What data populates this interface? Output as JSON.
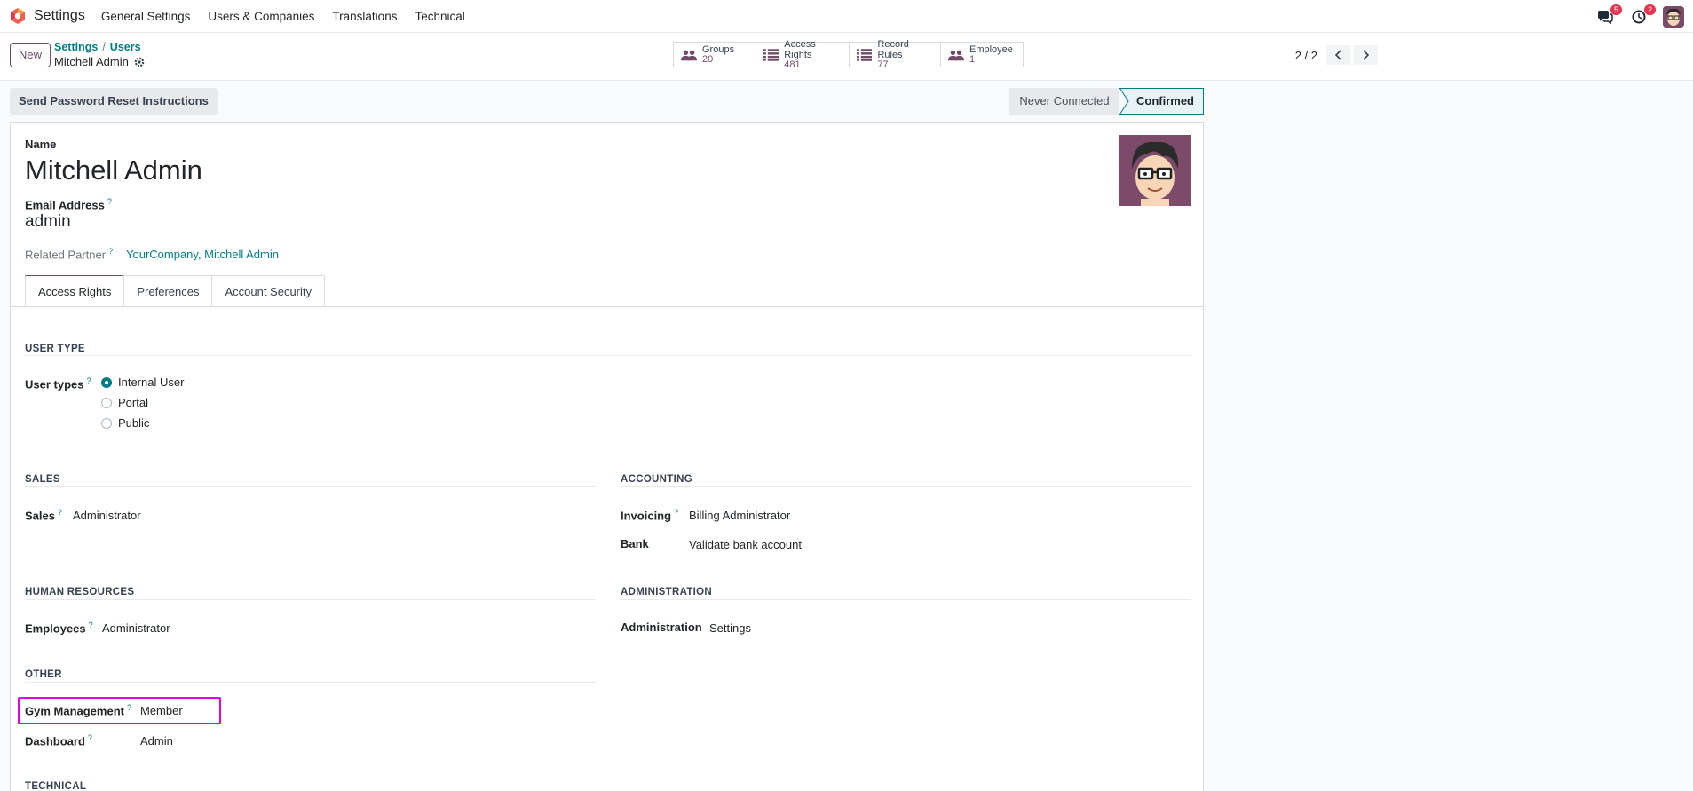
{
  "navbar": {
    "app_name": "Settings",
    "menus": [
      "General Settings",
      "Users & Companies",
      "Translations",
      "Technical"
    ],
    "messages_count": "5",
    "activities_count": "2"
  },
  "control_panel": {
    "new_label": "New",
    "breadcrumb_settings": "Settings",
    "breadcrumb_sep": "/",
    "breadcrumb_users": "Users",
    "record_name": "Mitchell Admin",
    "stats": [
      {
        "label": "Groups",
        "value": "20"
      },
      {
        "label": "Access Rights",
        "value": "481"
      },
      {
        "label": "Record Rules",
        "value": "77"
      },
      {
        "label": "Employee",
        "value": "1"
      }
    ],
    "pager": "2 / 2"
  },
  "statusbar": {
    "reset_button": "Send Password Reset Instructions",
    "stage_never": "Never Connected",
    "stage_confirmed": "Confirmed"
  },
  "form": {
    "name_label": "Name",
    "name_value": "Mitchell Admin",
    "email_label": "Email Address",
    "email_value": "admin",
    "partner_label": "Related Partner",
    "partner_value": "YourCompany, Mitchell Admin",
    "help_mark": "?"
  },
  "tabs": [
    "Access Rights",
    "Preferences",
    "Account Security"
  ],
  "access": {
    "user_type_title": "USER TYPE",
    "user_types_label": "User types",
    "user_type_options": [
      "Internal User",
      "Portal",
      "Public"
    ],
    "sales_title": "SALES",
    "sales_label": "Sales",
    "sales_value": "Administrator",
    "accounting_title": "ACCOUNTING",
    "invoicing_label": "Invoicing",
    "invoicing_value": "Billing Administrator",
    "bank_label": "Bank",
    "bank_value": "Validate bank account",
    "hr_title": "HUMAN RESOURCES",
    "employees_label": "Employees",
    "employees_value": "Administrator",
    "admin_title": "ADMINISTRATION",
    "administration_label": "Administration",
    "administration_value": "Settings",
    "other_title": "OTHER",
    "gym_label": "Gym Management",
    "gym_value": "Member",
    "dashboard_label": "Dashboard",
    "dashboard_value": "Admin",
    "technical_title": "TECHNICAL"
  },
  "colors": {
    "brand": "#714b67",
    "accent": "#017e84",
    "highlight": "#e600e6",
    "badge": "#e2354f"
  }
}
